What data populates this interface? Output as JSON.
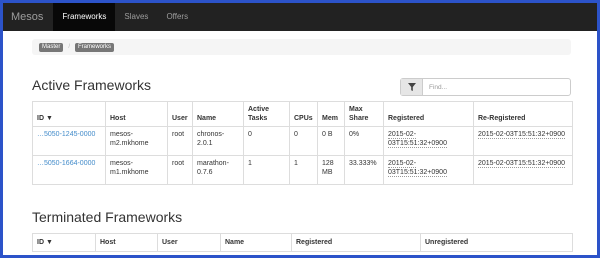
{
  "navbar": {
    "brand": "Mesos",
    "items": [
      {
        "label": "Frameworks",
        "active": true
      },
      {
        "label": "Slaves",
        "active": false
      },
      {
        "label": "Offers",
        "active": false
      }
    ]
  },
  "breadcrumb": [
    "Master",
    "Frameworks"
  ],
  "breadcrumb_separator": "/",
  "active": {
    "title": "Active Frameworks",
    "filter_placeholder": "Find...",
    "columns": [
      "ID ▼",
      "Host",
      "User",
      "Name",
      "Active Tasks",
      "CPUs",
      "Mem",
      "Max Share",
      "Registered",
      "Re-Registered"
    ],
    "rows": [
      {
        "id": "…5050-1245-0000",
        "host": "mesos-m2.mkhome",
        "user": "root",
        "name": "chronos-2.0.1",
        "tasks": "0",
        "cpus": "0",
        "mem": "0 B",
        "share": "0%",
        "registered": "2015-02-03T15:51:32+0900",
        "reregistered": "2015-02-03T15:51:32+0900"
      },
      {
        "id": "…5050-1664-0000",
        "host": "mesos-m1.mkhome",
        "user": "root",
        "name": "marathon-0.7.6",
        "tasks": "1",
        "cpus": "1",
        "mem": "128 MB",
        "share": "33.333%",
        "registered": "2015-02-03T15:51:32+0900",
        "reregistered": "2015-02-03T15:51:32+0900"
      }
    ]
  },
  "terminated": {
    "title": "Terminated Frameworks",
    "columns": [
      "ID ▼",
      "Host",
      "User",
      "Name",
      "Registered",
      "Unregistered"
    ]
  },
  "colors": {
    "navbar": "#222222",
    "link": "#428bca",
    "outer_border": "#2c53c9"
  }
}
